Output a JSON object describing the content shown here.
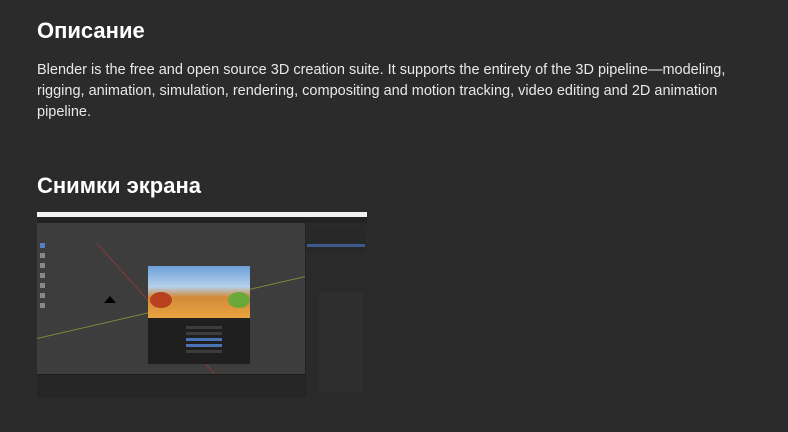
{
  "description": {
    "heading": "Описание",
    "text": "Blender is the free and open source 3D creation suite. It supports the entirety of the 3D pipeline—modeling, rigging, animation, simulation, rendering, compositing and motion tracking, video editing and 2D animation pipeline."
  },
  "screenshots": {
    "heading": "Снимки экрана",
    "items": [
      {
        "alt": "Blender"
      }
    ]
  }
}
